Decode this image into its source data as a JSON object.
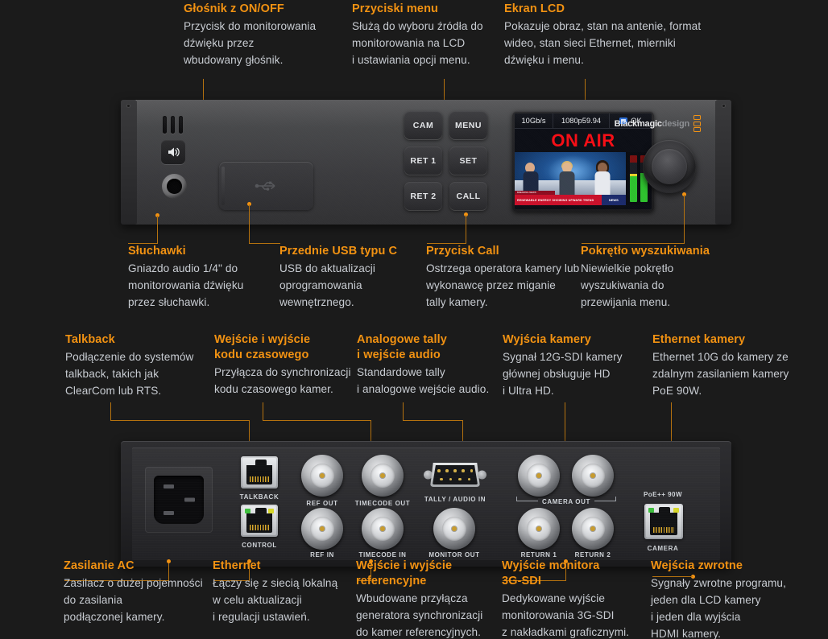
{
  "product": {
    "brand_name": "Blackmagic",
    "brand_suffix": "design"
  },
  "front_callouts_top": [
    {
      "title": "Głośnik z ON/OFF",
      "body": "Przycisk do monitorowania\ndźwięku przez\nwbudowany głośnik."
    },
    {
      "title": "Przyciski menu",
      "body": "Służą do wyboru źródła do\nmonitorowania na LCD\ni ustawiania opcji menu."
    },
    {
      "title": "Ekran LCD",
      "body": "Pokazuje obraz, stan na antenie, format\nwideo, stan sieci Ethernet, mierniki\ndźwięku i menu."
    }
  ],
  "front_callouts_bottom": [
    {
      "title": "Słuchawki",
      "body": "Gniazdo audio 1/4\" do\nmonitorowania dźwięku\nprzez słuchawki."
    },
    {
      "title": "Przednie USB typu C",
      "body": "USB do aktualizacji\noprogramowania\nwewnętrznego."
    },
    {
      "title": "Przycisk Call",
      "body": "Ostrzega operatora kamery lub\nwykonawcę przez miganie\ntally kamery."
    },
    {
      "title": "Pokrętło wyszukiwania",
      "body": "Niewielkie pokrętło\nwyszukiwania do\nprzewijania menu."
    }
  ],
  "rear_callouts_top": [
    {
      "title": "Talkback",
      "body": "Podłączenie do systemów\ntalkback, takich jak\nClearCom lub RTS."
    },
    {
      "title": "Wejście i wyjście\nkodu czasowego",
      "body": "Przyłącza do synchronizacji\nkodu czasowego kamer."
    },
    {
      "title": "Analogowe tally\ni wejście audio",
      "body": "Standardowe tally\ni analogowe wejście audio."
    },
    {
      "title": "Wyjścia kamery",
      "body": "Sygnał 12G-SDI kamery\ngłównej obsługuje HD\ni Ultra HD."
    },
    {
      "title": "Ethernet kamery",
      "body": "Ethernet 10G do kamery ze\nzdalnym zasilaniem kamery\nPoE 90W."
    }
  ],
  "rear_callouts_bottom": [
    {
      "title": "Zasilanie AC",
      "body": "Zasilacz o dużej pojemności\ndo zasilania\npodłączonej kamery."
    },
    {
      "title": "Ethernet",
      "body": "Łączy się z siecią lokalną\nw celu aktualizacji\ni regulacji ustawień."
    },
    {
      "title": "Wejście i wyjście\nreferencyjne",
      "body": "Wbudowane przyłącza\ngeneratora synchronizacji\ndo kamer referencyjnych."
    },
    {
      "title": "Wyjście monitora\n3G-SDI",
      "body": "Dedykowane wyjście\nmonitorowania 3G-SDI\nz nakładkami graficznymi."
    },
    {
      "title": "Wejścia zwrotne",
      "body": "Sygnały zwrotne programu,\njeden dla LCD kamery\ni jeden dla wyjścia\nHDMI kamery."
    }
  ],
  "front_panel": {
    "keys": [
      "CAM",
      "MENU",
      "RET 1",
      "SET",
      "RET 2",
      "CALL"
    ],
    "lcd": {
      "link_rate": "10Gb/s",
      "video_format": "1080p59.94",
      "network_status": "OK",
      "on_air_text": "ON AIR",
      "ticker_headline": "RENEWABLE ENERGY SHOWING UPWARD TREND",
      "ticker_kicker": "BREAKING NEWS",
      "ticker_logo": "NEWS"
    }
  },
  "rear_panel": {
    "labels": {
      "talkback": "TALKBACK",
      "control": "CONTROL",
      "ref_out": "REF OUT",
      "ref_in": "REF IN",
      "timecode_out": "TIMECODE OUT",
      "timecode_in": "TIMECODE IN",
      "tally_audio_in": "TALLY / AUDIO IN",
      "monitor_out": "MONITOR OUT",
      "camera_out": "CAMERA OUT",
      "return_1": "RETURN 1",
      "return_2": "RETURN 2",
      "poe": "PoE++ 90W",
      "camera": "CAMERA"
    }
  },
  "colors": {
    "accent": "#f29212",
    "leader": "#b5720f",
    "body_text": "#c8ccd2",
    "background": "#1b1b1b",
    "on_air_red": "#f60d15"
  }
}
